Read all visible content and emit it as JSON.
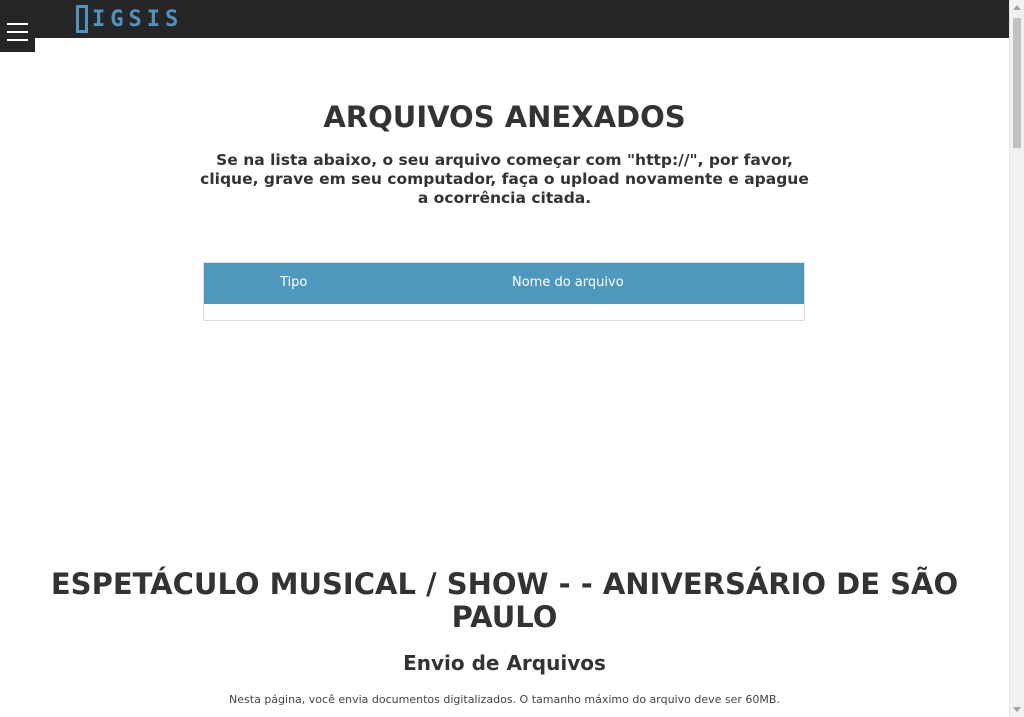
{
  "header": {
    "logo_text": "IGSIS",
    "menu_icon": "hamburger-menu-icon",
    "background": "#262626",
    "brand_color": "#4f94c0"
  },
  "attachments": {
    "title": "ARQUIVOS ANEXADOS",
    "instructions": "Se na lista abaixo, o seu arquivo começar com \"http://\", por favor, clique, grave em seu computador, faça o upload novamente e apague a ocorrência citada.",
    "table": {
      "header_color": "#4f98bd",
      "columns": [
        "Tipo",
        "Nome do arquivo"
      ],
      "rows": []
    }
  },
  "event": {
    "title": "ESPETÁCULO MUSICAL / SHOW - - ANIVERSÁRIO DE SÃO PAULO",
    "subtitle": "Envio de Arquivos",
    "note": "Nesta página, você envia documentos digitalizados. O tamanho máximo do arquivo deve ser 60MB."
  }
}
